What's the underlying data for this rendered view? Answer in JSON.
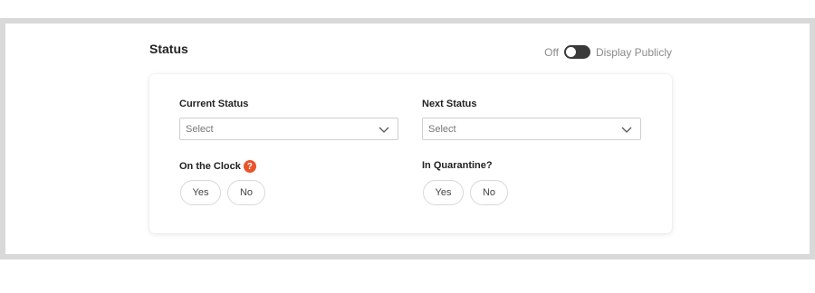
{
  "status": {
    "title": "Status",
    "toggle_state_label": "Off",
    "toggle_label": "Display Publicly"
  },
  "fields": {
    "current_status": {
      "label": "Current Status",
      "value": "Select"
    },
    "next_status": {
      "label": "Next Status",
      "value": "Select"
    },
    "on_the_clock": {
      "label": "On the Clock",
      "help": "?",
      "yes": "Yes",
      "no": "No"
    },
    "in_quarantine": {
      "label": "In Quarantine?",
      "yes": "Yes",
      "no": "No"
    }
  }
}
